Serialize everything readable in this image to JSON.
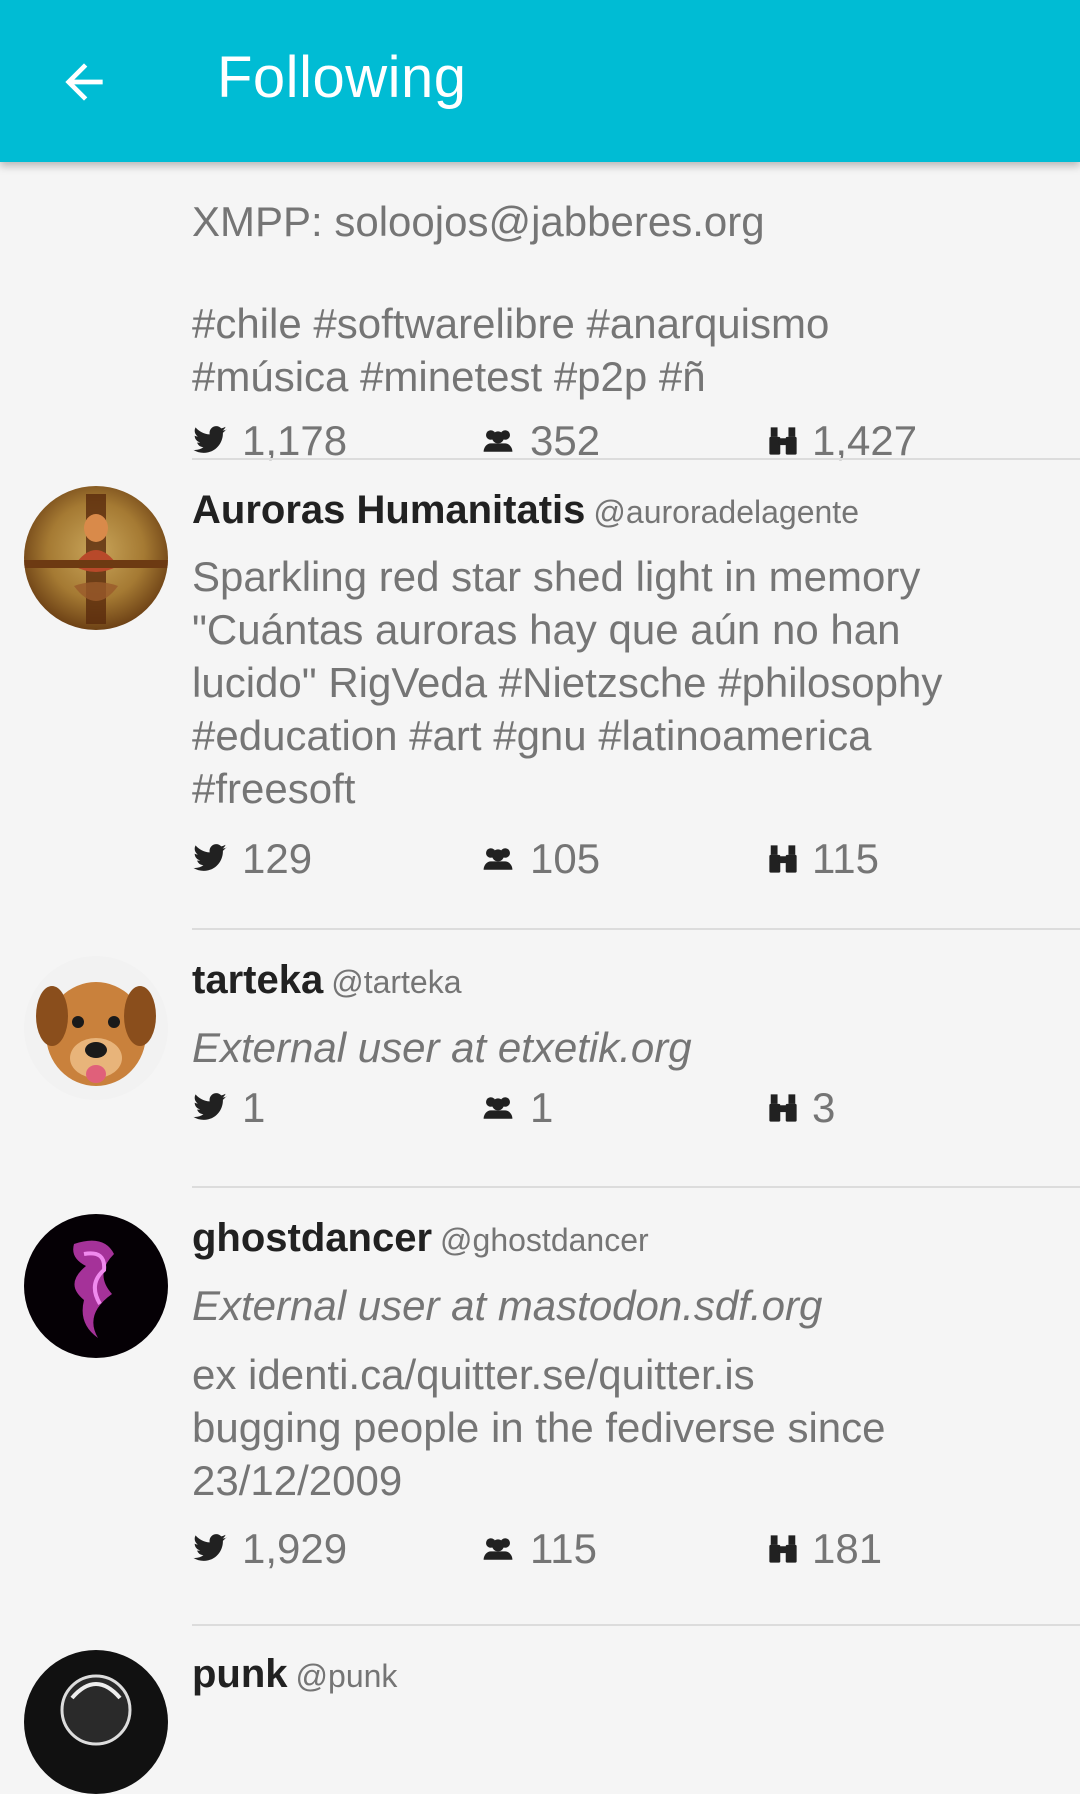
{
  "appbar": {
    "title": "Following",
    "back_icon": "arrow-left-icon",
    "color": "#00bcd4"
  },
  "entries": [
    {
      "bio_top_line": "XMPP: soloojos@jabberes.org",
      "bio": "#chile #softwarelibre #anarquismo\n#música #minetest #p2p #ñ",
      "notices": "1,178",
      "following": "352",
      "followers": "1,427"
    },
    {
      "name": "Auroras Humanitatis",
      "handle": "@auroradelagente",
      "bio": "Sparkling red star shed light in memory\n\"Cuántas auroras hay que aún no han\nlucido\" RigVeda #Nietzsche #philosophy\n#education #art #gnu #latinoamerica\n#freesoft",
      "notices": "129",
      "following": "105",
      "followers": "115"
    },
    {
      "name": "tarteka",
      "handle": "@tarteka",
      "external": "External user at etxetik.org",
      "notices": "1",
      "following": "1",
      "followers": "3"
    },
    {
      "name": "ghostdancer",
      "handle": "@ghostdancer",
      "external": "External user at mastodon.sdf.org",
      "bio": "ex identi.ca/quitter.se/quitter.is\nbugging people in the fediverse since\n23/12/2009",
      "notices": "1,929",
      "following": "115",
      "followers": "181"
    },
    {
      "name": "punk",
      "handle": "@punk"
    }
  ],
  "icons": {
    "notices": "bird-icon",
    "following": "group-icon",
    "followers": "binoculars-icon"
  }
}
